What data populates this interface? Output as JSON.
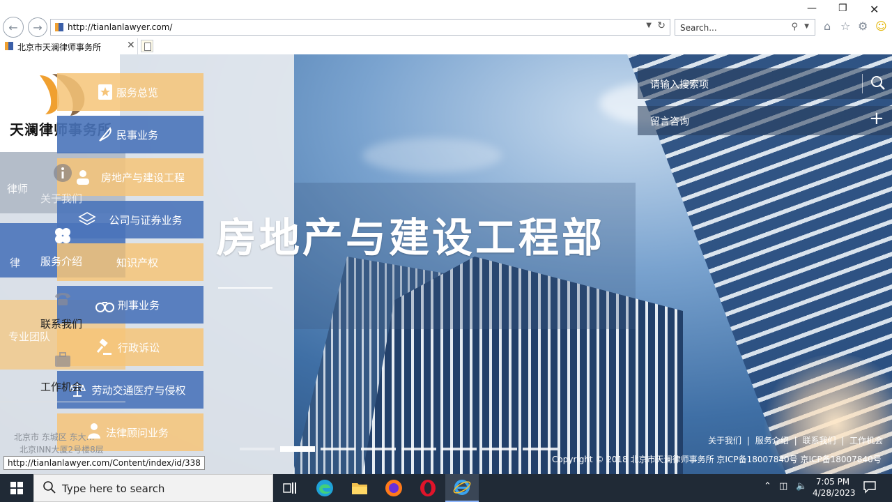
{
  "browser": {
    "url": "http://tianlanlawyer.com/",
    "search_placeholder": "Search...",
    "tab_title": "北京市天澜律师事务所",
    "status_url": "http://tianlanlawyer.com/Content/index/id/338"
  },
  "site": {
    "logo_text": "天澜律师事务所",
    "search_label": "请输入搜索项",
    "consult_label": "留言咨询",
    "banner_title": "房地产与建设工程部",
    "main_nav": [
      {
        "label": "关于我们"
      },
      {
        "label": "服务介绍"
      },
      {
        "label": "联系我们"
      },
      {
        "label": "工作机会"
      }
    ],
    "ghost_nav": [
      {
        "label": "律师"
      },
      {
        "label": "律"
      },
      {
        "label": "专业团队"
      }
    ],
    "sub_menu": [
      {
        "label": "服务总览"
      },
      {
        "label": "民事业务"
      },
      {
        "label": "房地产与建设工程"
      },
      {
        "label": "公司与证券业务"
      },
      {
        "label": "知识产权"
      },
      {
        "label": "刑事业务"
      },
      {
        "label": "行政诉讼"
      },
      {
        "label": "劳动交通医疗与侵权"
      },
      {
        "label": "法律顾问业务"
      }
    ],
    "address_lines": [
      "北京市 东城区 东大…",
      "北京INN大厦2号楼8层"
    ],
    "footer_links": [
      "关于我们",
      "|",
      "服务介绍",
      "|",
      "联系我们",
      "|",
      "工作机会"
    ],
    "copyright": "Copyright © 2018 北京市天澜律师事务所  京ICP备18007840号 京ICP备18007840号"
  },
  "taskbar": {
    "search_placeholder": "Type here to search",
    "time": "7:05 PM",
    "date": "4/28/2023"
  },
  "colors": {
    "accent_orange": "#f6c478",
    "accent_blue": "#4a74ba",
    "taskbar": "#202a36"
  }
}
